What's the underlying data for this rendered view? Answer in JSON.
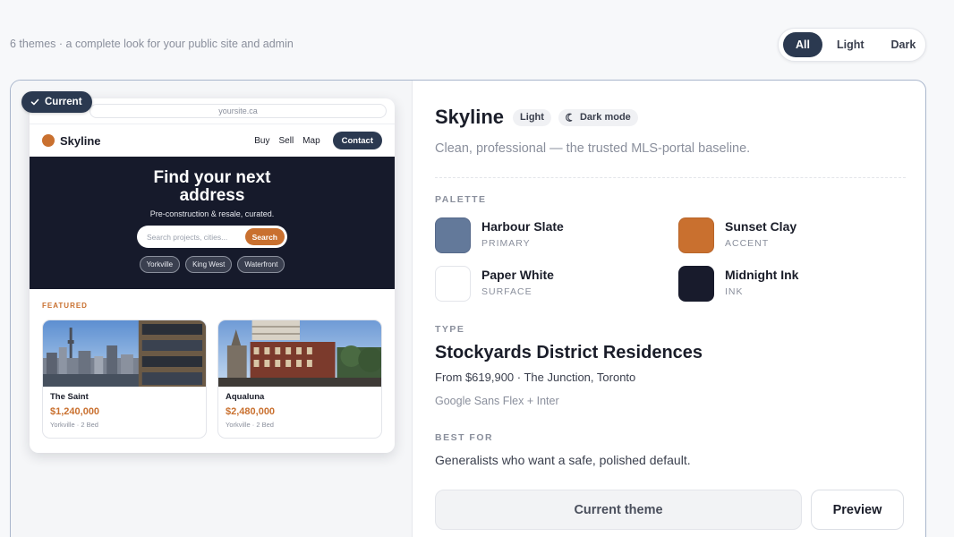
{
  "header": {
    "theme_count_text": "6 themes · a complete look for your public site and admin",
    "filters": [
      {
        "label": "All",
        "active": true
      },
      {
        "label": "Light",
        "active": false
      },
      {
        "label": "Dark",
        "active": false
      }
    ]
  },
  "card": {
    "current_badge": "Current",
    "preview": {
      "url": "yoursite.ca",
      "brand": "Skyline",
      "nav": [
        "Buy",
        "Sell",
        "Map"
      ],
      "nav_cta": "Contact",
      "hero_title": "Find your next address",
      "hero_subtitle": "Pre-construction & resale, curated.",
      "search_placeholder": "Search projects, cities...",
      "search_button": "Search",
      "chips": [
        "Yorkville",
        "King West",
        "Waterfront"
      ],
      "featured_label": "FEATURED",
      "listings": [
        {
          "name": "The Saint",
          "price": "$1,240,000",
          "meta": "Yorkville · 2 Bed"
        },
        {
          "name": "Aqualuna",
          "price": "$2,480,000",
          "meta": "Yorkville · 2 Bed"
        }
      ]
    },
    "details": {
      "name": "Skyline",
      "mode_pill": "Light",
      "dark_pill": "Dark mode",
      "tagline": "Clean, professional — the trusted MLS-portal baseline.",
      "palette_label": "PALETTE",
      "palette": [
        {
          "name": "Harbour Slate",
          "role": "PRIMARY",
          "color": "#63799a"
        },
        {
          "name": "Sunset Clay",
          "role": "ACCENT",
          "color": "#c9702f"
        },
        {
          "name": "Paper White",
          "role": "SURFACE",
          "color": "#ffffff"
        },
        {
          "name": "Midnight Ink",
          "role": "INK",
          "color": "#181b2c"
        }
      ],
      "type_label": "TYPE",
      "type_sample": "Stockyards District Residences",
      "type_meta": "From $619,900 · The Junction, Toronto",
      "fonts": "Google Sans Flex + Inter",
      "best_for_label": "BEST FOR",
      "best_for": "Generalists who want a safe, polished default.",
      "btn_current": "Current theme",
      "btn_preview": "Preview"
    }
  },
  "colors": {
    "accent": "#c9702f",
    "primary_dark": "#2b3950",
    "card_border": "#a9b6cc"
  }
}
